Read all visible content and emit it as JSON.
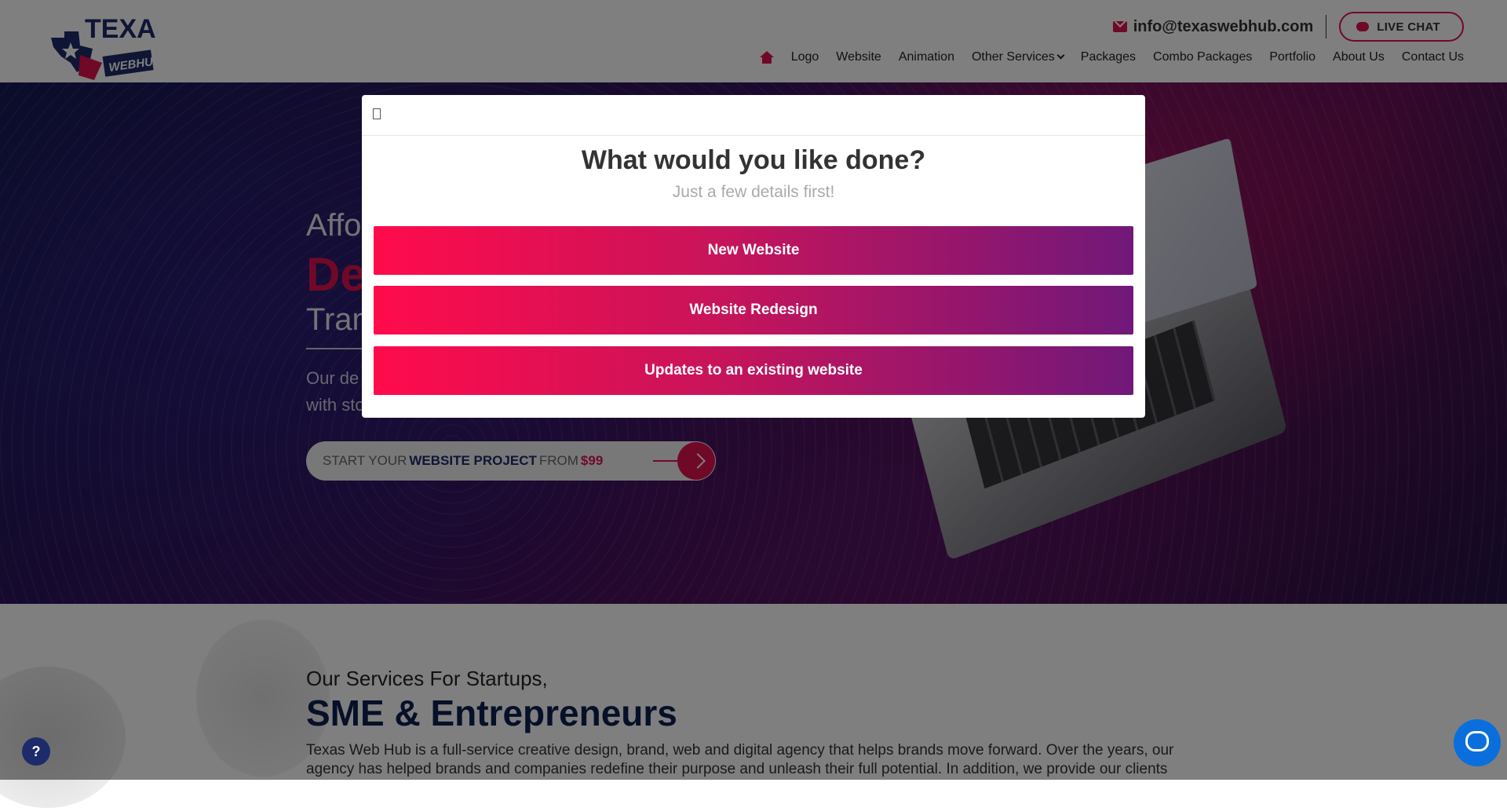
{
  "header": {
    "logo_text": "TEXAS",
    "logo_sub": "WEBHUB",
    "email": "info@texaswebhub.com",
    "live_chat": "LIVE CHAT",
    "nav": [
      "Logo",
      "Website",
      "Animation",
      "Other Services",
      "Packages",
      "Combo Packages",
      "Portfolio",
      "About Us",
      "Contact Us"
    ]
  },
  "hero": {
    "line1": "Affo",
    "line2": "De",
    "line3": "Tran",
    "para1": "Our de",
    "para2": "with sto",
    "cta": {
      "part1": "START YOUR",
      "part2": "WEBSITE PROJECT",
      "part3": "FROM",
      "price": "$99"
    }
  },
  "services": {
    "subtitle": "Our Services For Startups,",
    "title": "SME & Entrepreneurs",
    "body": "Texas Web Hub is a full-service creative design, brand, web and digital agency that helps brands move forward. Over the years, our agency has helped brands and companies redefine their purpose and unleash their full potential. In addition, we provide our clients"
  },
  "modal": {
    "close_glyph": "",
    "title": "What would you like done?",
    "subtitle": "Just a few details first!",
    "options": [
      "New Website",
      "Website Redesign",
      "Updates to an existing website"
    ]
  },
  "help_badge": "?",
  "colors": {
    "accent": "#e0124f",
    "navy": "#0d2150",
    "gradient_start": "#ff0b4c",
    "gradient_end": "#71187a",
    "chat_widget": "#0a6fdc"
  }
}
